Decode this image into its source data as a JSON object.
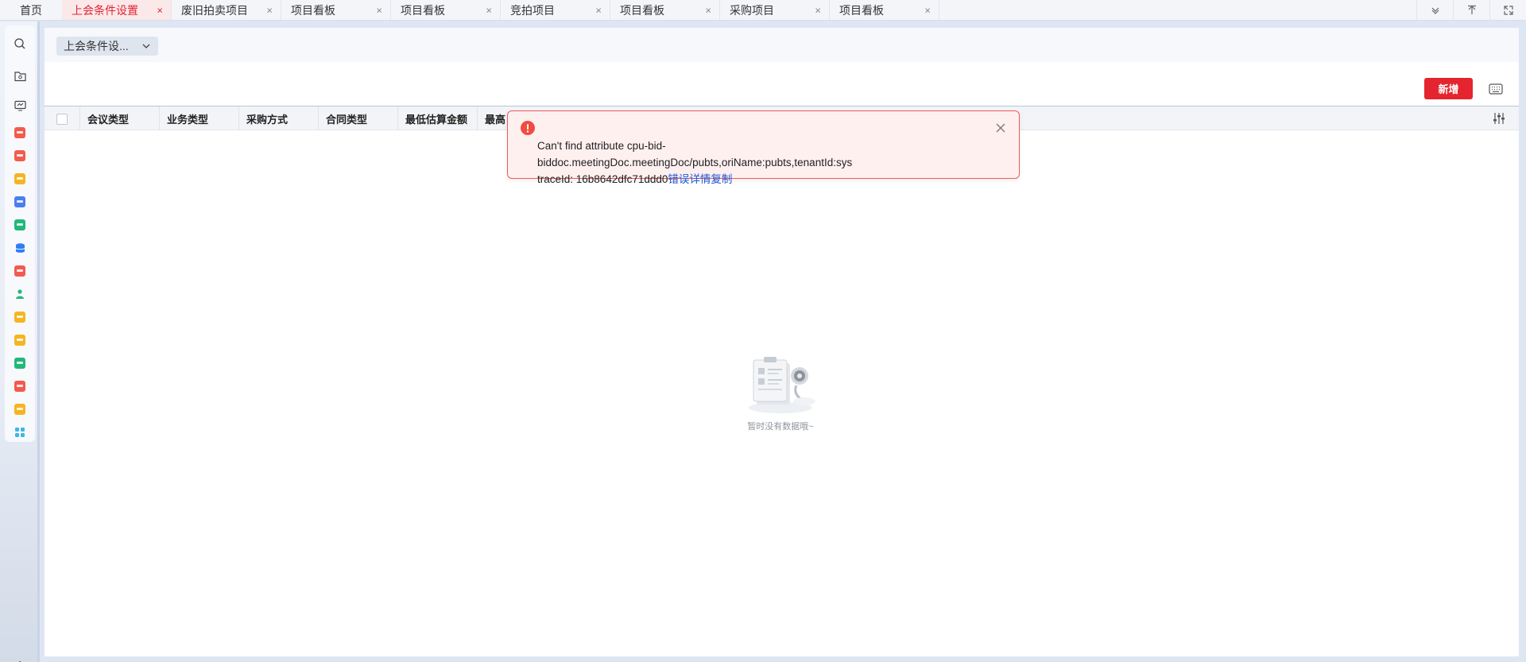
{
  "tabbar": {
    "home_label": "首页",
    "tabs": [
      {
        "label": "上会条件设置",
        "close": "×",
        "active": true
      },
      {
        "label": "废旧拍卖项目",
        "close": "×",
        "active": false
      },
      {
        "label": "项目看板",
        "close": "×",
        "active": false
      },
      {
        "label": "项目看板",
        "close": "×",
        "active": false
      },
      {
        "label": "竞拍项目",
        "close": "×",
        "active": false
      },
      {
        "label": "项目看板",
        "close": "×",
        "active": false
      },
      {
        "label": "采购项目",
        "close": "×",
        "active": false
      },
      {
        "label": "项目看板",
        "close": "×",
        "active": false
      }
    ],
    "right_icons": [
      "chevron-down-icon",
      "upload-icon",
      "fullscreen-icon"
    ]
  },
  "sidebar": {
    "tools": [
      "search-icon",
      "folder-icon",
      "monitor-icon"
    ],
    "apps": [
      {
        "icon": "app-red-icon",
        "color": "#f25b4f"
      },
      {
        "icon": "app-red-icon",
        "color": "#f25b4f"
      },
      {
        "icon": "app-yellow-icon",
        "color": "#f5b522"
      },
      {
        "icon": "app-blue-icon",
        "color": "#4b7ff0"
      },
      {
        "icon": "app-green-icon",
        "color": "#21b87a"
      },
      {
        "icon": "app-database-icon",
        "color": "#2f7df6"
      },
      {
        "icon": "app-red-icon",
        "color": "#f25b4f"
      },
      {
        "icon": "app-person-icon",
        "color": "#21b87a"
      },
      {
        "icon": "app-cart-icon",
        "color": "#f5b522"
      },
      {
        "icon": "app-cart-icon",
        "color": "#f5b522"
      },
      {
        "icon": "app-green-icon",
        "color": "#21b87a"
      },
      {
        "icon": "app-red-icon",
        "color": "#f25b4f"
      },
      {
        "icon": "app-cart-icon",
        "color": "#f5b522"
      },
      {
        "icon": "app-grid-icon",
        "color": "#3fb6e8"
      }
    ],
    "bottom_icon": "settings-icon"
  },
  "filter": {
    "dropdown_value": "上会条件设..."
  },
  "toolbar": {
    "add_label": "新增",
    "keyboard_icon": "keyboard-icon"
  },
  "grid": {
    "columns": [
      "会议类型",
      "业务类型",
      "采购方式",
      "合同类型",
      "最低估算金额",
      "最高"
    ],
    "settings_icon": "column-settings-icon",
    "empty_text": "暂时没有数据哦~"
  },
  "toast": {
    "message": "Can't find attribute cpu-bid-\nbiddoc.meetingDoc.meetingDoc/pubts,oriName:pubts,tenantId:sys",
    "trace": "traceId: 16b8642dfc71ddd0",
    "link": "错误详情复制",
    "accent": "#e4252f"
  },
  "colors": {
    "brand_red": "#e4252f",
    "link_blue": "#1f5bd8"
  }
}
